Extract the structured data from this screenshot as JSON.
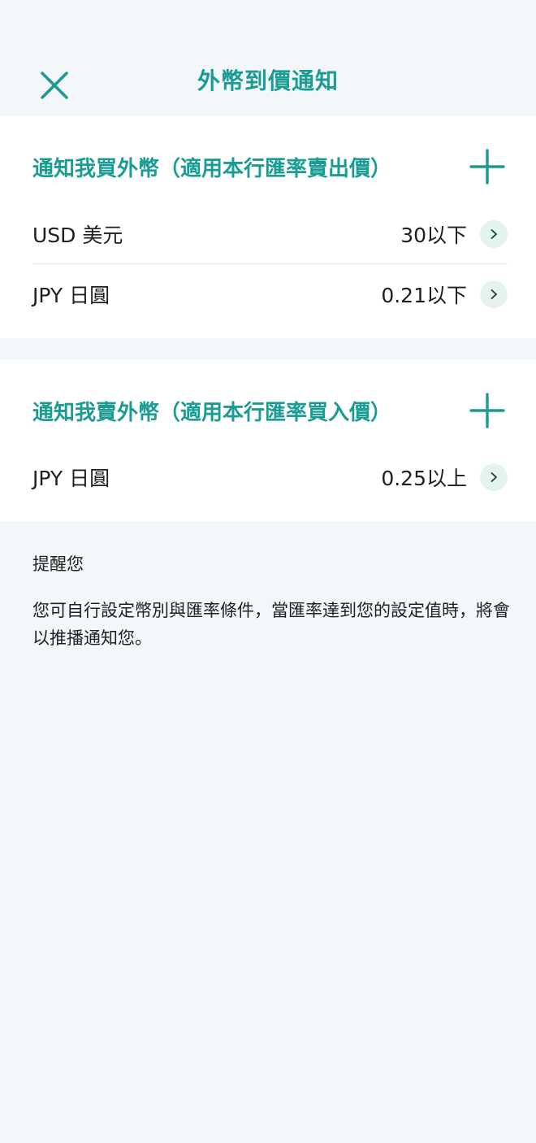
{
  "header": {
    "title": "外幣到價通知",
    "close_icon": "close-icon"
  },
  "colors": {
    "accent": "#1a9c93",
    "background": "#f3f7fa",
    "card": "#ffffff",
    "chevron_bg": "#e4f2f0"
  },
  "buy_section": {
    "title": "通知我買外幣（適用本行匯率賣出價）",
    "add_icon": "plus-icon",
    "items": [
      {
        "currency": "USD 美元",
        "condition": "30以下"
      },
      {
        "currency": "JPY 日圓",
        "condition": "0.21以下"
      }
    ]
  },
  "sell_section": {
    "title": "通知我賣外幣（適用本行匯率買入價）",
    "add_icon": "plus-icon",
    "items": [
      {
        "currency": "JPY 日圓",
        "condition": "0.25以上"
      }
    ]
  },
  "reminder": {
    "title": "提醒您",
    "text": "您可自行設定幣別與匯率條件，當匯率達到您的設定值時，將會以推播通知您。"
  }
}
